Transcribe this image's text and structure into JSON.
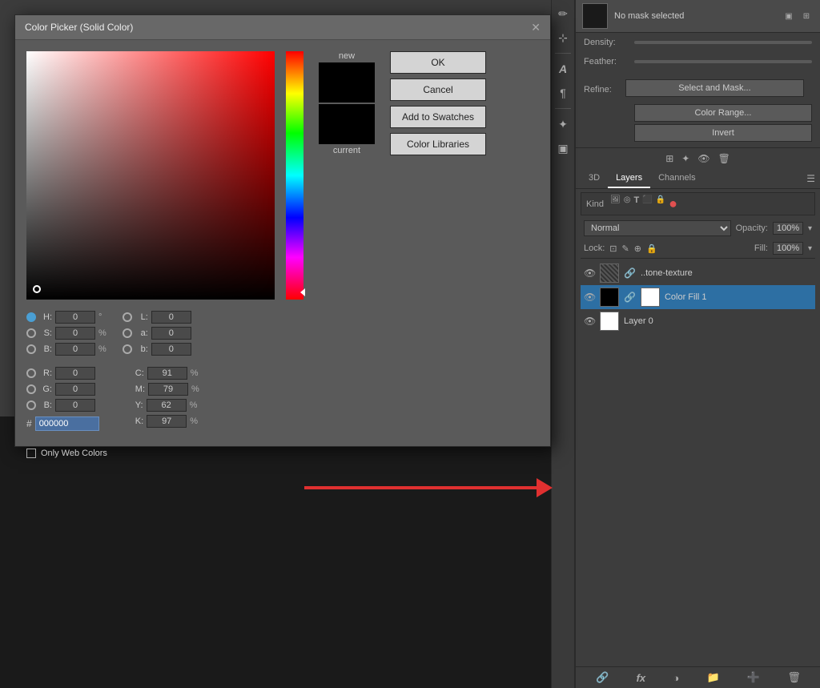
{
  "dialog": {
    "title": "Color Picker (Solid Color)",
    "close_label": "✕",
    "preview": {
      "new_label": "new",
      "current_label": "current"
    },
    "buttons": {
      "ok": "OK",
      "cancel": "Cancel",
      "add_to_swatches": "Add to Swatches",
      "color_libraries": "Color Libraries"
    },
    "color_fields": {
      "H_label": "H:",
      "H_value": "0",
      "H_unit": "°",
      "S_label": "S:",
      "S_value": "0",
      "S_unit": "%",
      "B_label": "B:",
      "B_value": "0",
      "B_unit": "%",
      "R_label": "R:",
      "R_value": "0",
      "G_label": "G:",
      "G_value": "0",
      "B2_label": "B:",
      "B2_value": "0",
      "L_label": "L:",
      "L_value": "0",
      "a_label": "a:",
      "a_value": "0",
      "b_label": "b:",
      "b_value": "0",
      "C_label": "C:",
      "C_value": "91",
      "C_unit": "%",
      "M_label": "M:",
      "M_value": "79",
      "M_unit": "%",
      "Y_label": "Y:",
      "Y_value": "62",
      "Y_unit": "%",
      "K_label": "K:",
      "K_value": "97",
      "K_unit": "%",
      "hex_hash": "#",
      "hex_value": "000000"
    },
    "webcol_label": "Only Web Colors"
  },
  "right_panel": {
    "mask_title": "No mask selected",
    "density_label": "Density:",
    "feather_label": "Feather:",
    "refine_label": "Refine:",
    "select_mask_btn": "Select and Mask...",
    "color_range_btn": "Color Range...",
    "invert_btn": "Invert",
    "tabs": {
      "3d": "3D",
      "layers": "Layers",
      "channels": "Channels"
    },
    "search": {
      "kind_label": "Kind",
      "placeholder": ""
    },
    "blend": {
      "mode": "Normal",
      "opacity_label": "Opacity:",
      "opacity_value": "100%"
    },
    "lock": {
      "label": "Lock:",
      "fill_label": "Fill:",
      "fill_value": "100%"
    },
    "layers": [
      {
        "name": "..tone-texture",
        "visible": true,
        "type": "texture"
      },
      {
        "name": "Color Fill 1",
        "visible": true,
        "type": "fill",
        "active": true
      },
      {
        "name": "Layer 0",
        "visible": true,
        "type": "normal"
      }
    ]
  }
}
